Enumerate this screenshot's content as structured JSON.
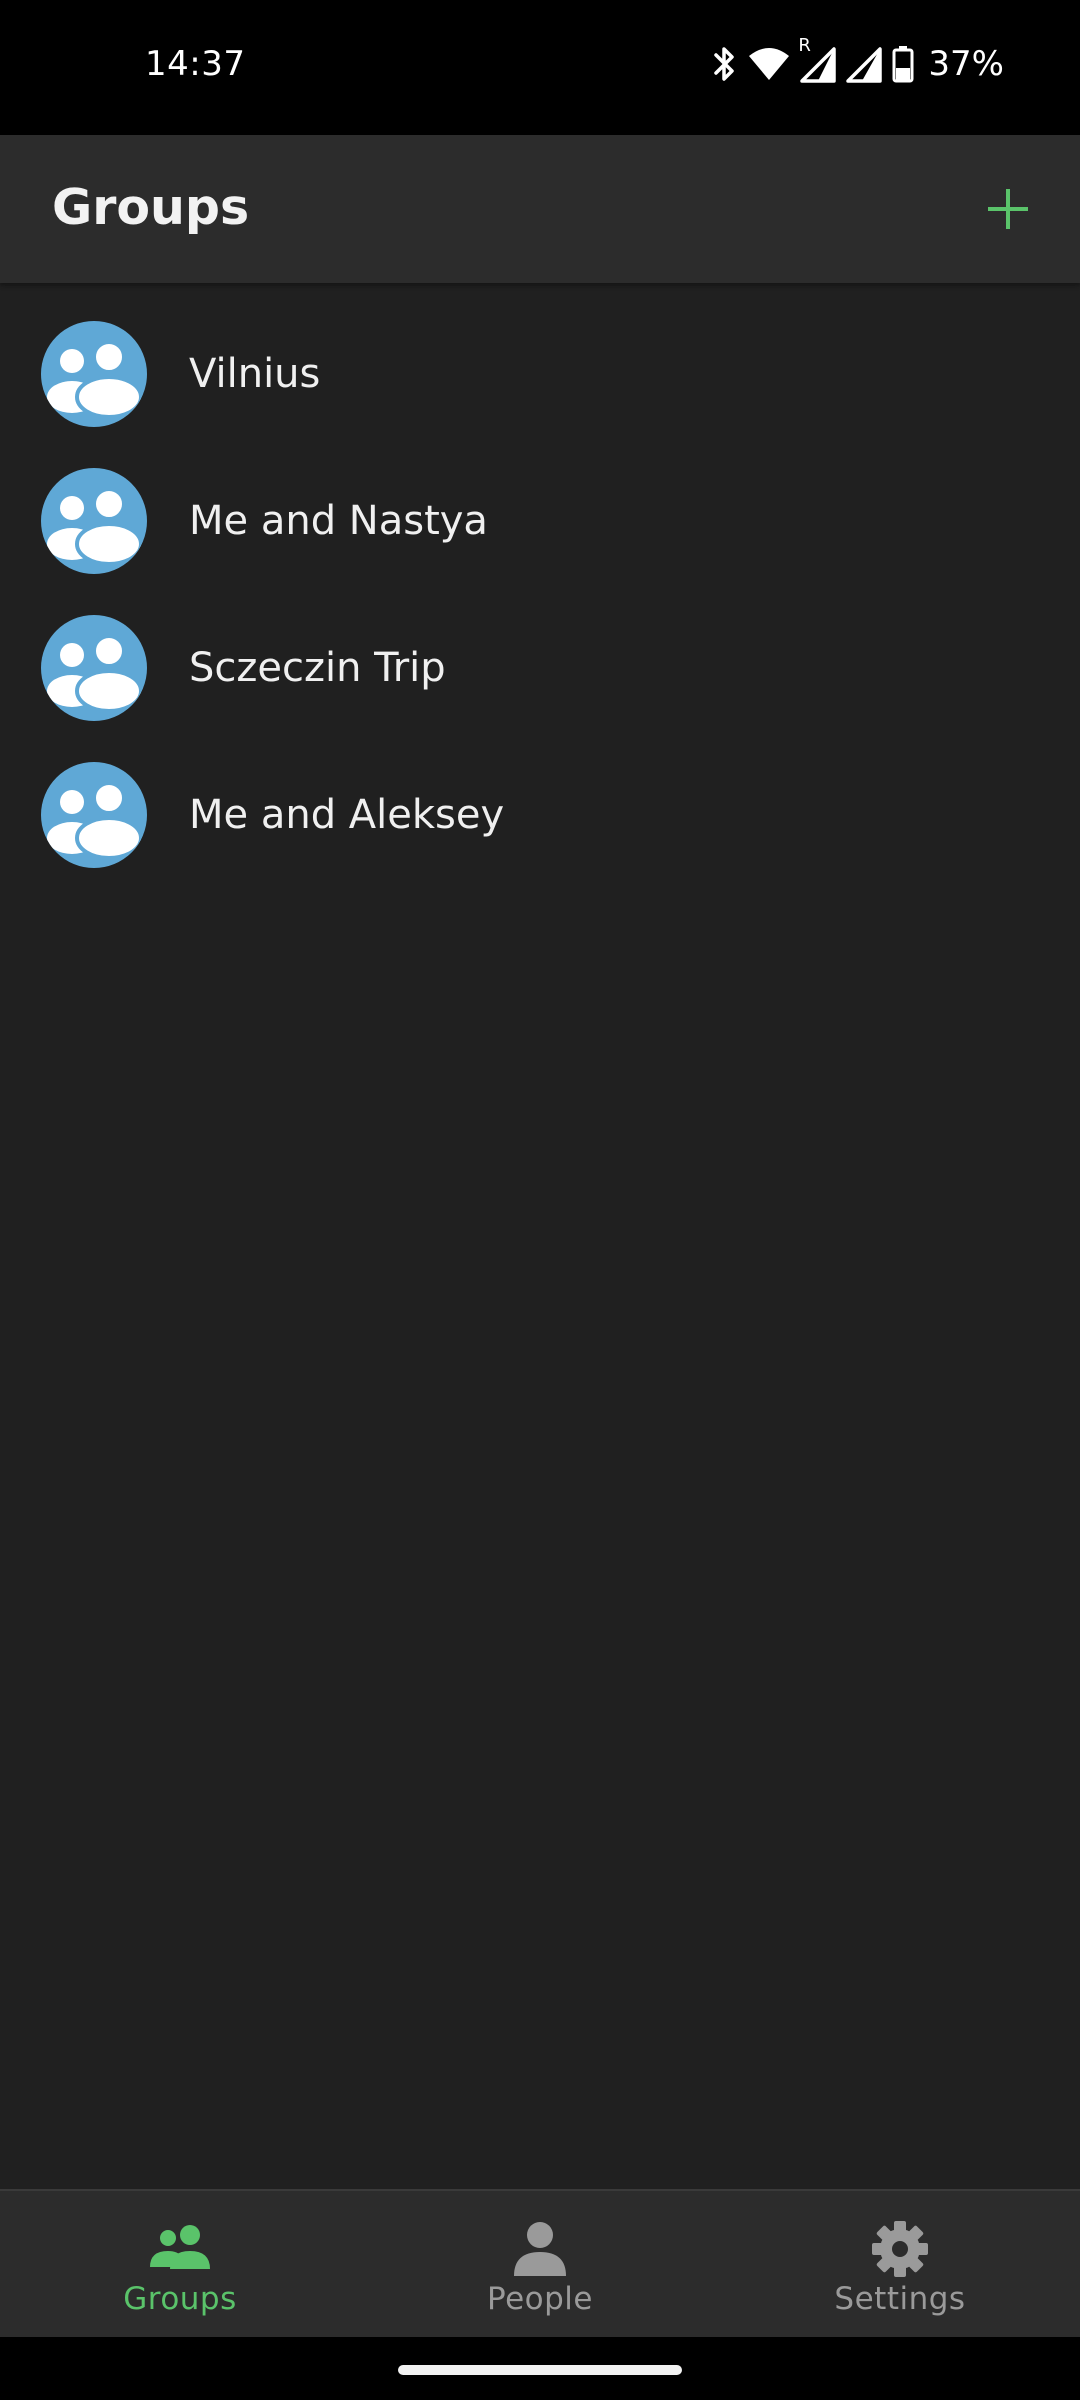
{
  "status_bar": {
    "time": "14:37",
    "roaming_indicator": "R",
    "battery_percent": "37%",
    "icons": [
      "bluetooth-icon",
      "wifi-icon",
      "signal-roaming-icon",
      "signal-icon",
      "battery-icon"
    ]
  },
  "app_bar": {
    "title": "Groups",
    "add_icon": "plus-icon",
    "accent_color": "#5ac36a"
  },
  "groups": [
    {
      "name": "Vilnius",
      "icon": "group-avatar-icon"
    },
    {
      "name": "Me and Nastya",
      "icon": "group-avatar-icon"
    },
    {
      "name": "Sczeczin Trip",
      "icon": "group-avatar-icon"
    },
    {
      "name": "Me and Aleksey",
      "icon": "group-avatar-icon"
    }
  ],
  "bottom_nav": {
    "items": [
      {
        "label": "Groups",
        "icon": "groups-icon",
        "selected": true
      },
      {
        "label": "People",
        "icon": "person-icon",
        "selected": false
      },
      {
        "label": "Settings",
        "icon": "gear-icon",
        "selected": false
      }
    ],
    "selected_color": "#5ac36a",
    "unselected_color": "#9a9a9a"
  },
  "colors": {
    "background": "#202020",
    "surface": "#2c2c2c",
    "avatar": "#5fa8d6"
  }
}
